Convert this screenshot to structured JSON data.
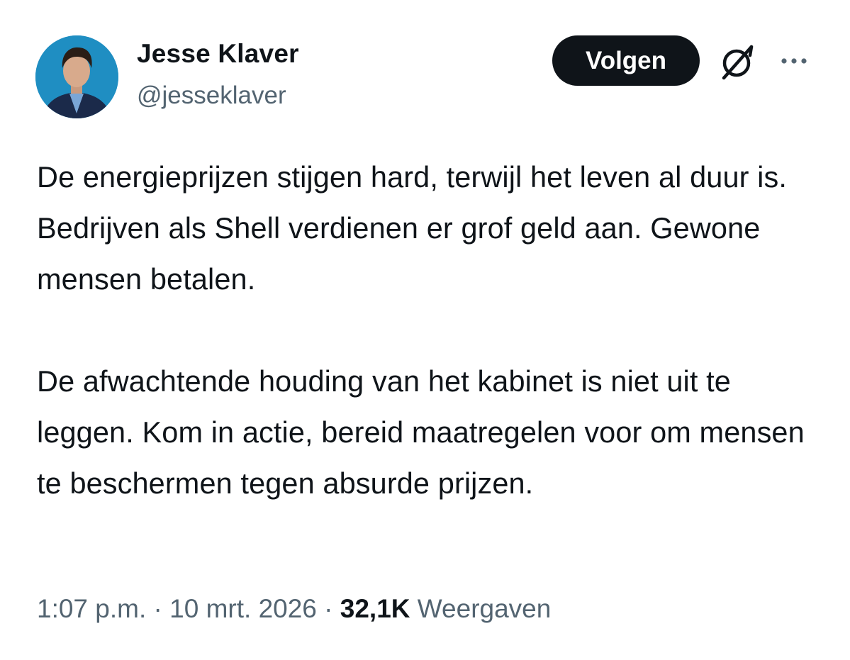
{
  "author": {
    "display_name": "Jesse Klaver",
    "handle": "@jesseklaver",
    "avatar_icon": "profile-photo"
  },
  "actions": {
    "follow_label": "Volgen",
    "grok_icon": "grok-icon",
    "more_icon": "more-dots-icon"
  },
  "tweet": {
    "paragraphs": [
      "De energieprijzen stijgen hard, terwijl het leven al duur is. Bedrijven als Shell verdienen er grof geld aan. Gewone mensen betalen.",
      "De afwachtende houding van het kabinet is niet uit te leggen. Kom in actie, bereid maatregelen voor om mensen te beschermen tegen absurde prijzen."
    ]
  },
  "meta": {
    "time": "1:07 p.m.",
    "separator": "·",
    "date": "10 mrt. 2026",
    "views_count": "32,1K",
    "views_label": "Weergaven"
  },
  "colors": {
    "text_primary": "#0f1419",
    "text_secondary": "#536471",
    "button_bg": "#0f1419",
    "avatar_bg": "#1f8ec2"
  }
}
